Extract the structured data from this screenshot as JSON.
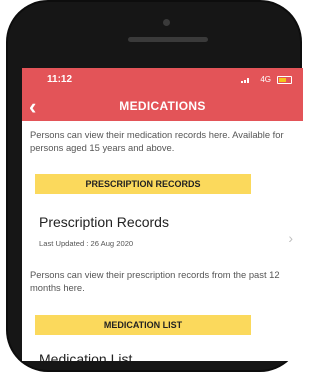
{
  "status_bar": {
    "time": "11:12",
    "network": "4G",
    "battery_color": "#f4c61b"
  },
  "app_bar": {
    "title": "MEDICATIONS",
    "back_icon": "chevron-left-icon",
    "color": "#e35458"
  },
  "intro_text": "Persons can view their medication records here. Available for persons aged 15 years and above.",
  "sections": [
    {
      "banner": "PRESCRIPTION RECORDS",
      "item_title": "Prescription Records",
      "item_subtitle": "Last Updated : 26 Aug 2020",
      "description": "Persons can view their prescription records from the past 12 months here."
    },
    {
      "banner": "MEDICATION LIST",
      "item_title": "Medication List"
    }
  ],
  "colors": {
    "banner": "#fbd95c"
  }
}
